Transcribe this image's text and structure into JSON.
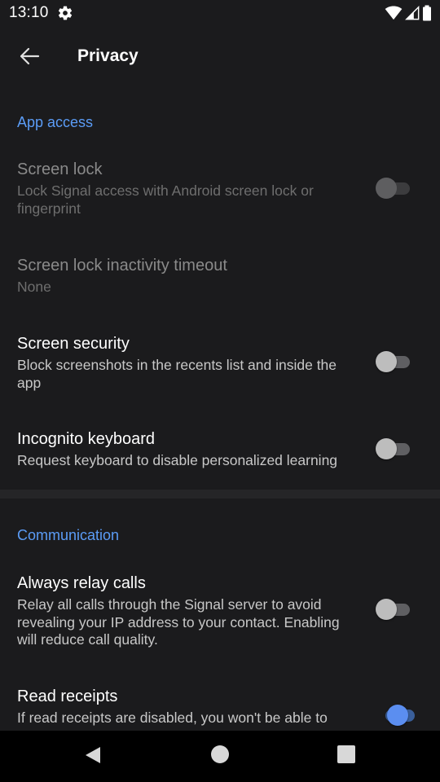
{
  "status_bar": {
    "time": "13:10",
    "icons": [
      "settings-gear-icon",
      "wifi-icon",
      "signal-icon",
      "battery-icon"
    ]
  },
  "app_bar": {
    "title": "Privacy",
    "back_icon": "arrow-left-icon"
  },
  "sections": {
    "app_access": {
      "header": "App access",
      "screen_lock": {
        "title": "Screen lock",
        "summary": "Lock Signal access with Android screen lock or fingerprint",
        "enabled": false,
        "checked": false
      },
      "screen_lock_timeout": {
        "title": "Screen lock inactivity timeout",
        "summary": "None",
        "enabled": false
      },
      "screen_security": {
        "title": "Screen security",
        "summary": "Block screenshots in the recents list and inside the app",
        "checked": false
      },
      "incognito_keyboard": {
        "title": "Incognito keyboard",
        "summary": "Request keyboard to disable personalized learning",
        "checked": false
      }
    },
    "communication": {
      "header": "Communication",
      "always_relay_calls": {
        "title": "Always relay calls",
        "summary": "Relay all calls through the Signal server to avoid revealing your IP address to your contact. Enabling will reduce call quality.",
        "checked": false
      },
      "read_receipts": {
        "title": "Read receipts",
        "summary": "If read receipts are disabled, you won't be able to",
        "checked": true
      }
    }
  },
  "nav_bar": {
    "buttons": [
      "nav-back-icon",
      "nav-home-icon",
      "nav-recents-icon"
    ]
  },
  "colors": {
    "background": "#1b1b1d",
    "accent": "#5b9cf6",
    "switch_on": "#5b8ef0"
  }
}
